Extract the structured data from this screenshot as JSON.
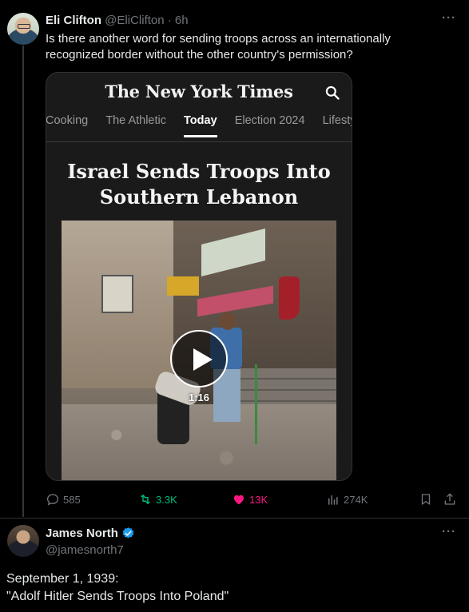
{
  "tweet1": {
    "display_name": "Eli Clifton",
    "handle": "@EliClifton",
    "time": "· 6h",
    "text": "Is there another word for sending troops across an internationally recognized border without the other country's permission?",
    "card": {
      "logo": "The New York Times",
      "tabs": [
        "Cooking",
        "The Athletic",
        "Today",
        "Election 2024",
        "Lifesty"
      ],
      "active_tab": "Today",
      "headline": "Israel Sends Troops Into Southern Lebanon",
      "video_duration": "1:16"
    },
    "stats": {
      "replies": "585",
      "reposts": "3.3K",
      "likes": "13K",
      "views": "274K"
    },
    "colors": {
      "repost": "#00ba7c",
      "like": "#f91880"
    }
  },
  "tweet2": {
    "display_name": "James North",
    "handle": "@jamesnorth7",
    "verified_color": "#1d9bf0",
    "line1": "September 1, 1939:",
    "line2": "\"Adolf Hitler Sends Troops Into Poland\""
  },
  "icons": [
    "reply-icon",
    "repost-icon",
    "like-icon",
    "views-icon",
    "bookmark-icon",
    "share-icon",
    "search-icon",
    "play-icon",
    "verified-icon",
    "more-icon"
  ]
}
